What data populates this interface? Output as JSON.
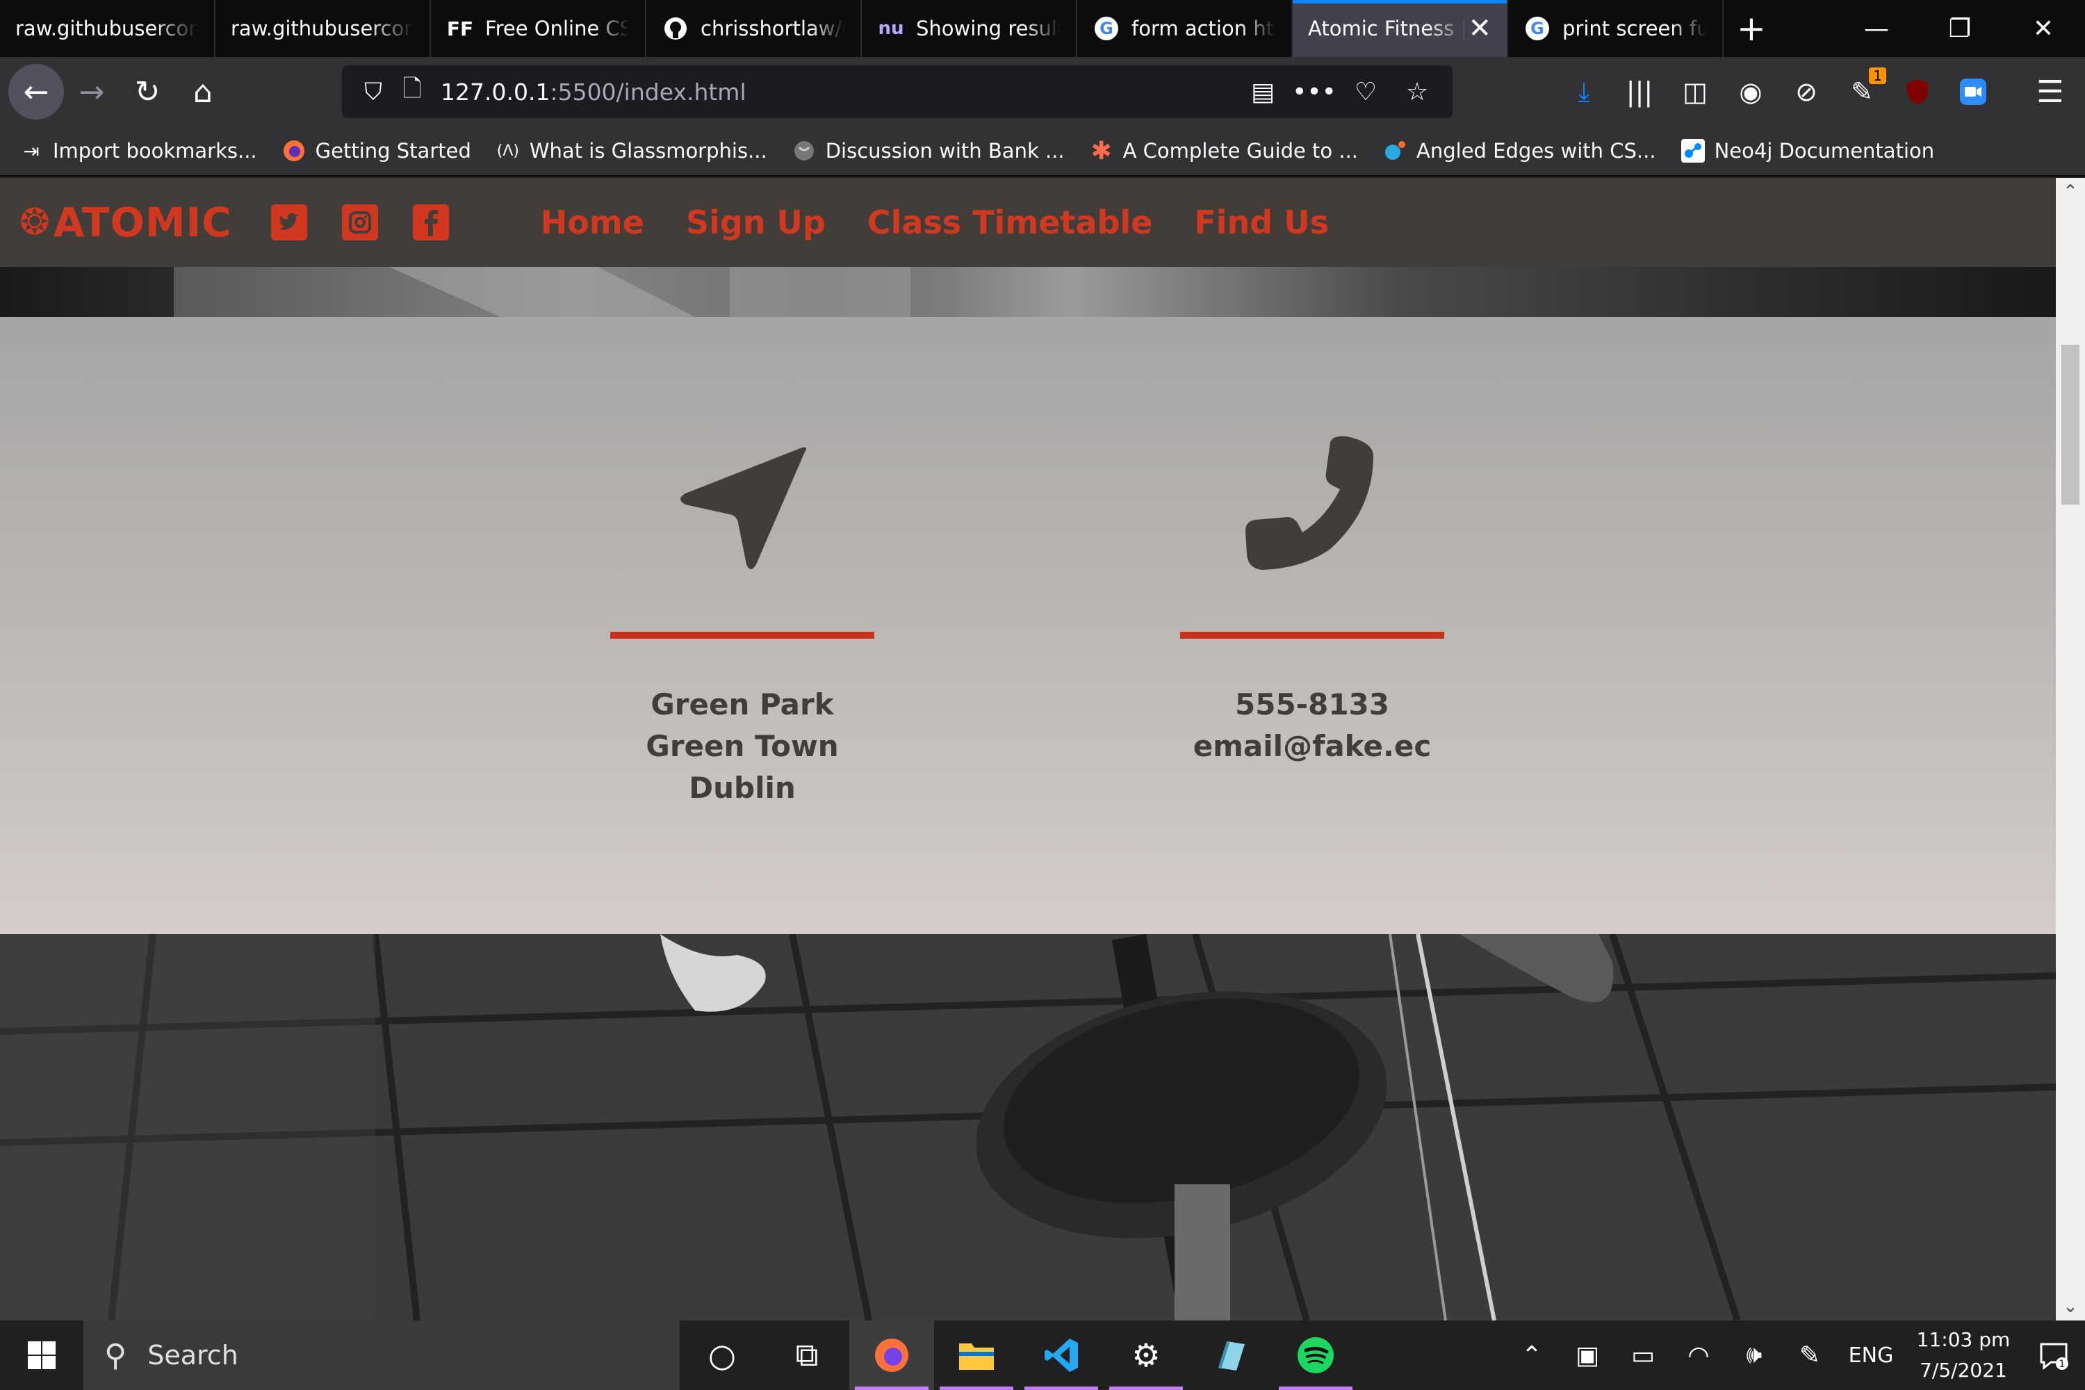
{
  "browser": {
    "tabs": [
      {
        "label": "raw.githubuserconte",
        "icon": "none",
        "active": false
      },
      {
        "label": "raw.githubuserconte",
        "icon": "none",
        "active": false
      },
      {
        "label": "Free Online CSS",
        "icon": "ff-icon",
        "active": false
      },
      {
        "label": "chrisshortlaw/c",
        "icon": "github-icon",
        "active": false
      },
      {
        "label": "Showing results",
        "icon": "nu-icon",
        "active": false
      },
      {
        "label": "form action htm",
        "icon": "google-icon",
        "active": false
      },
      {
        "label": "Atomic Fitness |",
        "icon": "none",
        "active": true
      },
      {
        "label": "print screen fun",
        "icon": "google-icon",
        "active": false
      }
    ],
    "url_host": "127.0.0.1",
    "url_path": ":5500/index.html",
    "downloads_badge": "1",
    "bookmarks": [
      {
        "label": "Import bookmarks...",
        "icon": "import-icon"
      },
      {
        "label": "Getting Started",
        "icon": "firefox-icon"
      },
      {
        "label": "What is Glassmorphis...",
        "icon": "code-icon"
      },
      {
        "label": "Discussion with Bank ...",
        "icon": "globe-icon"
      },
      {
        "label": "A Complete Guide to ...",
        "icon": "asterisk-icon"
      },
      {
        "label": "Angled Edges with CS...",
        "icon": "dot-icon"
      },
      {
        "label": "Neo4j Documentation",
        "icon": "neo4j-icon"
      }
    ]
  },
  "site": {
    "logo": "ATOMIC",
    "nav_links": [
      "Home",
      "Sign Up",
      "Class Timetable",
      "Find Us"
    ],
    "address_lines": [
      "Green Park",
      "Green Town",
      "Dublin"
    ],
    "contact_lines": [
      "555-8133",
      "email@fake.ec"
    ],
    "accent_color": "#d0381f",
    "nav_bg_color": "#433d3a"
  },
  "taskbar": {
    "search_label": "Search",
    "language": "ENG",
    "time": "11:03 pm",
    "date": "7/5/2021",
    "notification_count": "1"
  }
}
